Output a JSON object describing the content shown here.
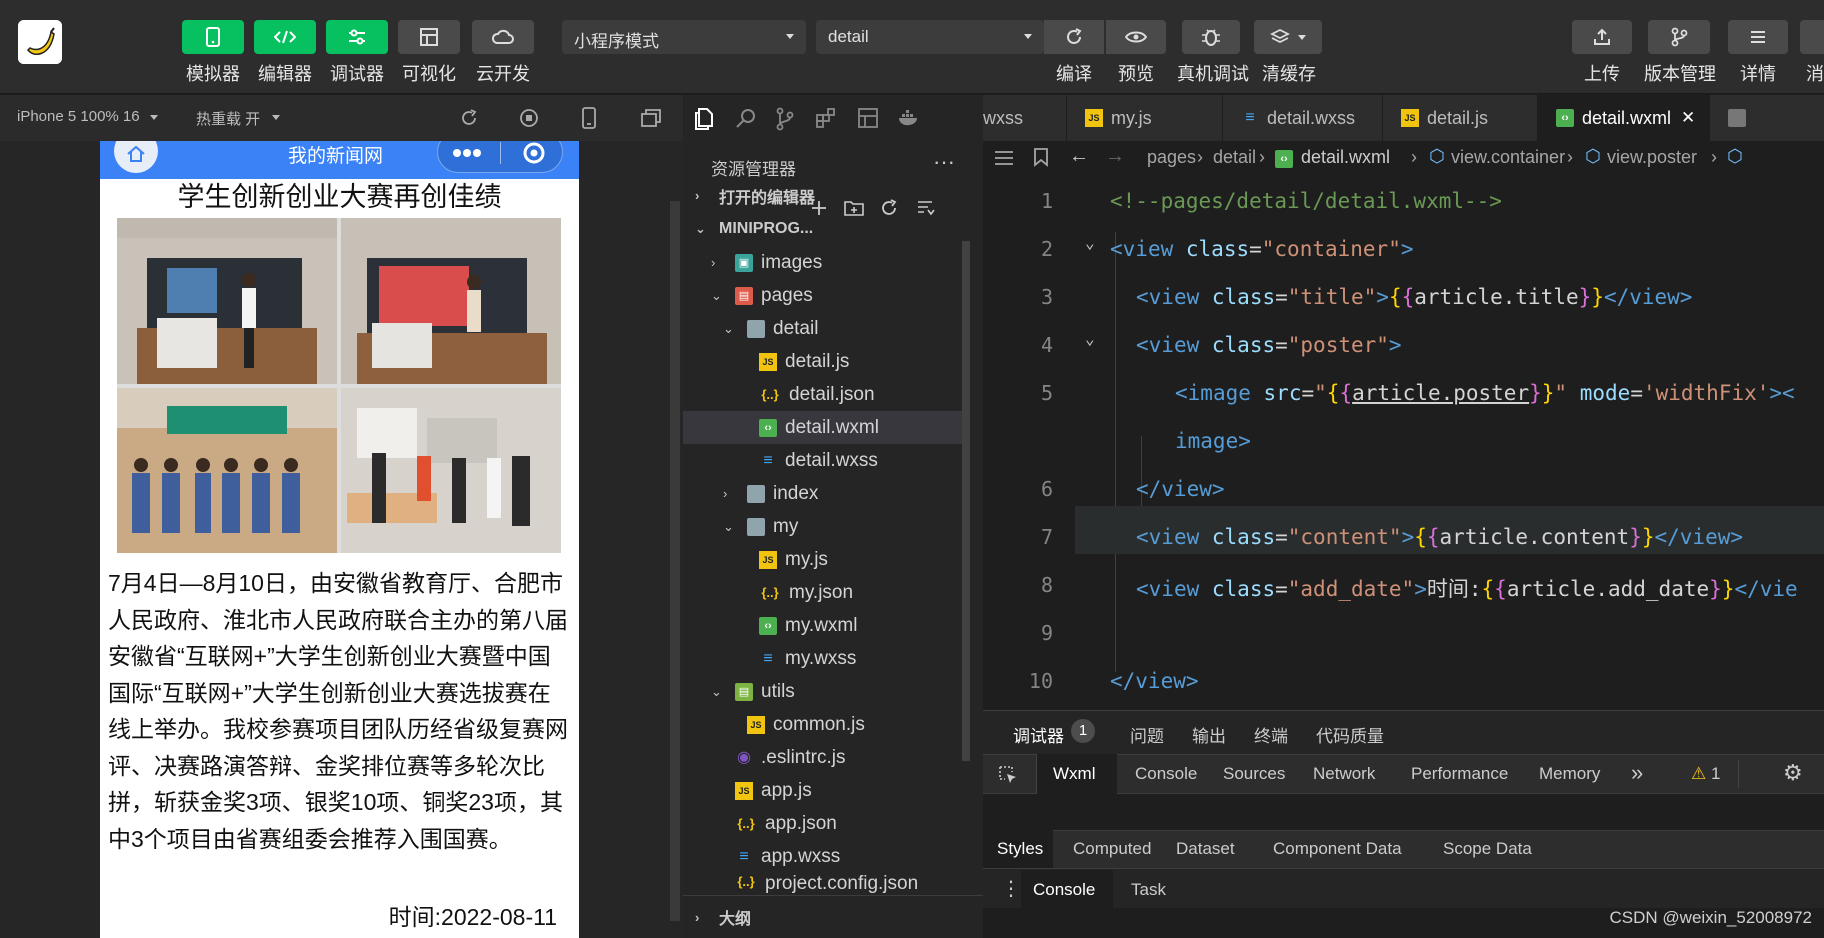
{
  "toolbar": {
    "buttons": [
      {
        "label": "模拟器"
      },
      {
        "label": "编辑器"
      },
      {
        "label": "调试器"
      },
      {
        "label": "可视化"
      },
      {
        "label": "云开发"
      }
    ],
    "mode_select": "小程序模式",
    "compile_select": "detail",
    "actions": [
      {
        "label": "编译"
      },
      {
        "label": "预览"
      },
      {
        "label": "真机调试"
      },
      {
        "label": "清缓存"
      }
    ],
    "right_actions": [
      {
        "label": "上传"
      },
      {
        "label": "版本管理"
      },
      {
        "label": "详情"
      },
      {
        "label": "消"
      }
    ]
  },
  "simulator": {
    "device": "iPhone 5 100% 16",
    "hot_reload": "热重载 开",
    "nav_title": "我的新闻网",
    "article_title": "学生创新创业大赛再创佳绩",
    "article_content": "7月4日—8月10日，由安徽省教育厅、合肥市人民政府、淮北市人民政府联合主办的第八届安徽省“互联网+”大学生创新创业大赛暨中国国际“互联网+”大学生创新创业大赛选拔赛在线上举办。我校参赛项目团队历经省级复赛网评、决赛路演答辩、金奖排位赛等多轮次比拼，斩获金奖3项、银奖10项、铜奖23项，其中3个项目由省赛组委会推荐入围国赛。",
    "article_date": "时间:2022-08-11"
  },
  "explorer": {
    "title": "资源管理器",
    "more": "···",
    "open_editors": "打开的编辑器",
    "project": "MINIPROG...",
    "items": [
      {
        "label": "images",
        "icon": "folder-images-icon"
      },
      {
        "label": "pages",
        "icon": "folder-pages-icon"
      },
      {
        "label": "detail",
        "icon": "folder-icon"
      },
      {
        "label": "detail.js",
        "icon": "js-icon"
      },
      {
        "label": "detail.json",
        "icon": "json-icon"
      },
      {
        "label": "detail.wxml",
        "icon": "wxml-icon"
      },
      {
        "label": "detail.wxss",
        "icon": "wxss-icon"
      },
      {
        "label": "index",
        "icon": "folder-icon"
      },
      {
        "label": "my",
        "icon": "folder-icon"
      },
      {
        "label": "my.js",
        "icon": "js-icon"
      },
      {
        "label": "my.json",
        "icon": "json-icon"
      },
      {
        "label": "my.wxml",
        "icon": "wxml-icon"
      },
      {
        "label": "my.wxss",
        "icon": "wxss-icon"
      },
      {
        "label": "utils",
        "icon": "folder-utils-icon"
      },
      {
        "label": "common.js",
        "icon": "js-icon"
      },
      {
        "label": ".eslintrc.js",
        "icon": "eslint-icon"
      },
      {
        "label": "app.js",
        "icon": "js-icon"
      },
      {
        "label": "app.json",
        "icon": "json-icon"
      },
      {
        "label": "app.wxss",
        "icon": "wxss-icon"
      },
      {
        "label": "project.config.json",
        "icon": "json-icon"
      }
    ],
    "outline": "大纲"
  },
  "editor": {
    "tabs": [
      "wxss",
      "my.js",
      "detail.wxss",
      "detail.js",
      "detail.wxml"
    ],
    "breadcrumb": [
      "pages",
      "detail",
      "detail.wxml",
      "view.container",
      "view.poster"
    ],
    "lines": [
      {
        "n": "1",
        "comment": "<!--pages/detail/detail.wxml-->"
      },
      {
        "n": "2",
        "tag": "view",
        "attr": "class",
        "val": "\"container\""
      },
      {
        "n": "3",
        "tag": "view",
        "attr": "class",
        "val": "\"title\"",
        "expr": "article.title"
      },
      {
        "n": "4",
        "tag": "view",
        "attr": "class",
        "val": "\"poster\""
      },
      {
        "n": "5",
        "tag": "image",
        "attr": "src",
        "expr": "article.poster",
        "attr2": "mode",
        "val2": "'widthFix'"
      },
      {
        "n": "",
        "wrap": "image>"
      },
      {
        "n": "6",
        "close": "</view>"
      },
      {
        "n": "7",
        "tag": "view",
        "attr": "class",
        "val": "\"content\"",
        "expr": "article.content"
      },
      {
        "n": "8",
        "tag": "view",
        "attr": "class",
        "val": "\"add_date\"",
        "text": "时间:",
        "expr": "article.add_date"
      },
      {
        "n": "9"
      },
      {
        "n": "10",
        "close": "</view>"
      }
    ]
  },
  "debugger": {
    "tabs": [
      "调试器",
      "问题",
      "输出",
      "终端",
      "代码质量"
    ],
    "badge": "1",
    "devtools_tabs": [
      "Wxml",
      "Console",
      "Sources",
      "Network",
      "Performance",
      "Memory"
    ],
    "more": "»",
    "warnings": "1",
    "style_tabs": [
      "Styles",
      "Computed",
      "Dataset",
      "Component Data",
      "Scope Data"
    ],
    "drawer_tabs": [
      "Console",
      "Task"
    ],
    "watermark": "CSDN @weixin_52008972"
  }
}
